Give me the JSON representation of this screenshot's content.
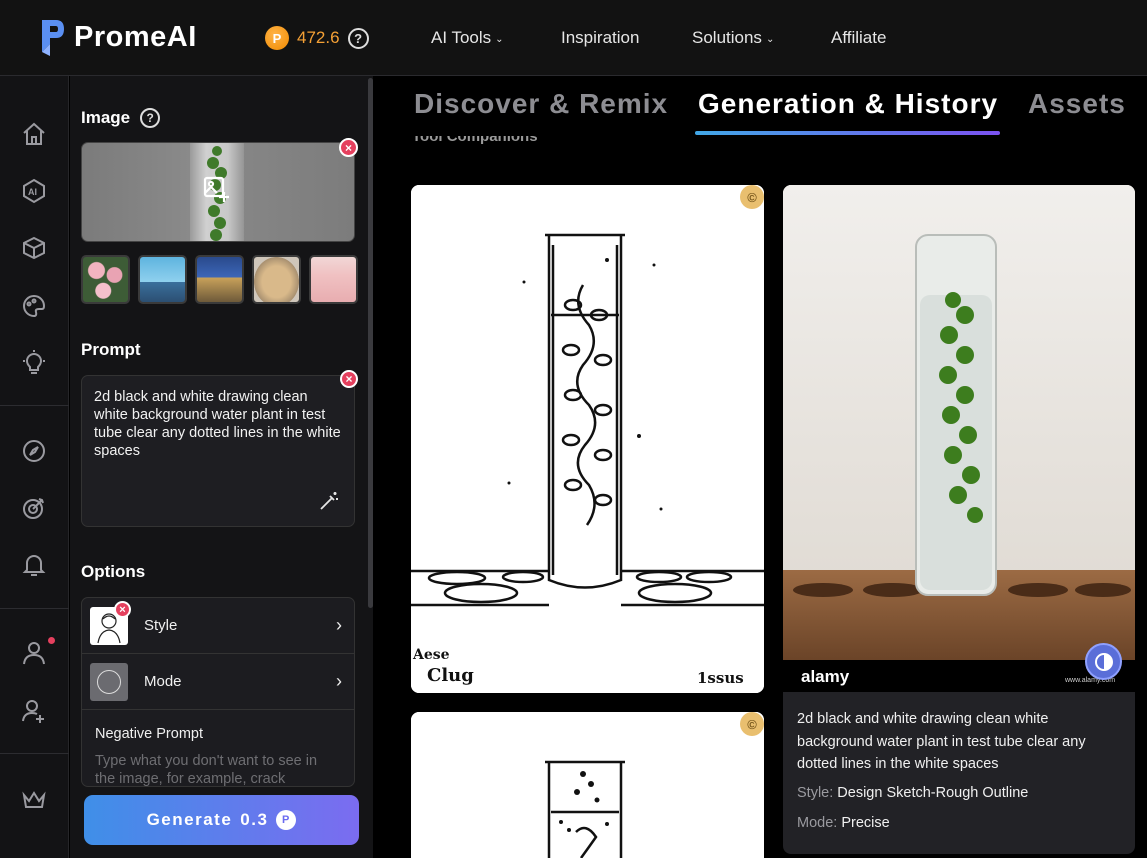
{
  "app": {
    "name": "PromeAI",
    "brand_color": "#4a8cf0",
    "accent_gradient": [
      "#3f8fe8",
      "#7b6cf0"
    ]
  },
  "header": {
    "credits": "472.6",
    "credits_help_icon": "question-circle-icon",
    "nav": [
      {
        "label": "AI Tools",
        "has_dropdown": true
      },
      {
        "label": "Inspiration",
        "has_dropdown": false
      },
      {
        "label": "Solutions",
        "has_dropdown": true
      },
      {
        "label": "Affiliate",
        "has_dropdown": false
      }
    ]
  },
  "rail": {
    "icons": [
      "home-icon",
      "ai-icon",
      "cube-icon",
      "palette-icon",
      "lightbulb-icon",
      "compass-icon",
      "target-icon",
      "bell-icon",
      "user-icon",
      "user-plus-icon",
      "crown-icon"
    ]
  },
  "panel": {
    "image_title": "Image",
    "image_help": "?",
    "prompt_title": "Prompt",
    "prompt_text": "2d black and white drawing clean white background water plant in test tube clear any dotted lines in the white spaces",
    "options_title": "Options",
    "options": [
      {
        "label": "Style"
      },
      {
        "label": "Mode"
      }
    ],
    "negative_prompt_title": "Negative Prompt",
    "negative_prompt_placeholder": "Type what you don't want to see in the image, for example, crack",
    "generate_label": "Generate",
    "generate_cost": "0.3"
  },
  "tabs": [
    {
      "label": "Discover & Remix",
      "active": false
    },
    {
      "label": "Generation & History",
      "active": true
    },
    {
      "label": "Assets",
      "active": false
    }
  ],
  "sub_heading_peek": "Tool Companions",
  "cards": {
    "first_caption_left": "Aese",
    "first_caption_bottom_left": "Clug",
    "first_caption_bottom_right": "1ssus",
    "photo_watermark": "alamy",
    "photo_watermark_right": "www.alamy.com"
  },
  "info": {
    "prompt": "2d black and white drawing clean white background water plant in test tube clear any dotted lines in the white spaces",
    "style_label": "Style:",
    "style_value": "Design Sketch-Rough Outline",
    "mode_label": "Mode:",
    "mode_value": "Precise"
  }
}
